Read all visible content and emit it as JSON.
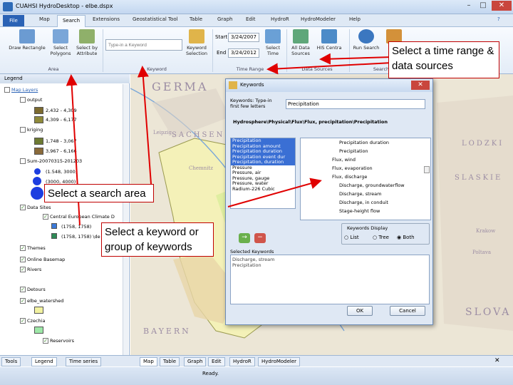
{
  "window": {
    "title": "CUAHSI HydroDesktop - elbe.dspx"
  },
  "ribbon_tabs": [
    "File",
    "Map",
    "Search",
    "Extensions",
    "Geostatistical Tool",
    "Table",
    "Graph",
    "Edit",
    "HydroR",
    "HydroModeler",
    "Help"
  ],
  "ribbon": {
    "buttons": {
      "draw_rectangle": "Draw Rectangle",
      "select_polygons": "Select Polygons",
      "select_by_attribute": "Select by Attribute",
      "keyword_selection": "Keyword Selection",
      "select_time": "Select Time",
      "all_data_sources": "All Data Sources",
      "his_central": "HIS Centra",
      "run_search": "Run Search"
    },
    "keyword_placeholder": "Type-in a Keyword",
    "start_label": "Start",
    "start_date": "3/24/2007",
    "end_label": "End",
    "end_date": "3/24/2012",
    "groups": {
      "area": "Area",
      "keyword": "Keyword",
      "time_range": "Time Range",
      "data_sources": "Data Sources",
      "search": "Search"
    }
  },
  "legend": {
    "title": "Legend",
    "map_layers": "Map Layers",
    "items": {
      "output": "output",
      "output_r1": "2,432 - 4,309",
      "output_r2": "4,309 - 6,177",
      "kriging": "kriging",
      "kriging_r1": "1,748 - 3,067",
      "kriging_r2": "3,967 - 6,166",
      "sum": "Sum-20070315-201203",
      "sum_r1": "(1.548, 3000)",
      "sum_r2": "(3000, 4000)",
      "data_sites": "Data Sites",
      "cedb": "Central European Climate D",
      "cedb_r1": "(1758, 1758)",
      "cedb_r2": "(1758, 1758) \\de",
      "themes": "Themes",
      "basemap": "Online Basemap",
      "rivers": "Rivers",
      "detours": "Detours",
      "watershed": "elbe_watershed",
      "czechia": "Czechia",
      "reservoirs": "Reservoirs"
    }
  },
  "map_labels": [
    "GERMA",
    "SACHSEN",
    "Leipzig",
    "Chemnitz",
    "BAYERN",
    "SLASKIE",
    "LODZKI",
    "SLOVA",
    "Krakow",
    "Poltava"
  ],
  "dialog": {
    "title": "Keywords",
    "prompt": "Keywords: Type-in first few letters",
    "input_value": "Precipitation",
    "path": "Hydrosphere\\Physical\\Flux\\Flux, precipitation\\Precipitation",
    "keyword_list": [
      {
        "text": "Precipitation",
        "selected": true
      },
      {
        "text": "Precipitation amount",
        "selected": true
      },
      {
        "text": "Precipitation duration",
        "selected": true
      },
      {
        "text": "Precipitation event dur",
        "selected": true
      },
      {
        "text": "Precipitation, duration",
        "selected": true
      },
      {
        "text": "Pressure",
        "selected": false
      },
      {
        "text": "Pressure, air",
        "selected": false
      },
      {
        "text": "Pressure, gauge",
        "selected": false
      },
      {
        "text": "Pressure, water",
        "selected": false
      },
      {
        "text": "Radium-226 Cubic",
        "selected": false
      }
    ],
    "tree": [
      "Precipitation duration",
      "Precipitation",
      "Flux, wind",
      "Flux, evaporation",
      "Flux, discharge",
      "Discharge, groundwaterflow",
      "Discharge, stream",
      "Discharge, in conduit",
      "Stage-height flow"
    ],
    "display_label": "Keywords Display",
    "radio": {
      "list": "List",
      "tree": "Tree",
      "both": "Both"
    },
    "selected_label": "Selected Keywords",
    "selected_keywords": [
      "Discharge, stream",
      "Precipitation"
    ],
    "ok": "OK",
    "cancel": "Cancel"
  },
  "bottom_tabs": [
    "Map",
    "Table",
    "Graph",
    "Edit",
    "HydroR",
    "HydroModeler"
  ],
  "bottom_left_tabs": [
    "Tools",
    "Legend",
    "Time series"
  ],
  "status": "Ready.",
  "callouts": {
    "time": "Select a time range & data sources",
    "area": "Select a search area",
    "keyword": "Select a keyword or group of keywords"
  },
  "colors": {
    "callout_border": "#c00000",
    "arrow": "#e00000",
    "selection": "#3a6fd4",
    "title_blue": "#2a62b5"
  }
}
